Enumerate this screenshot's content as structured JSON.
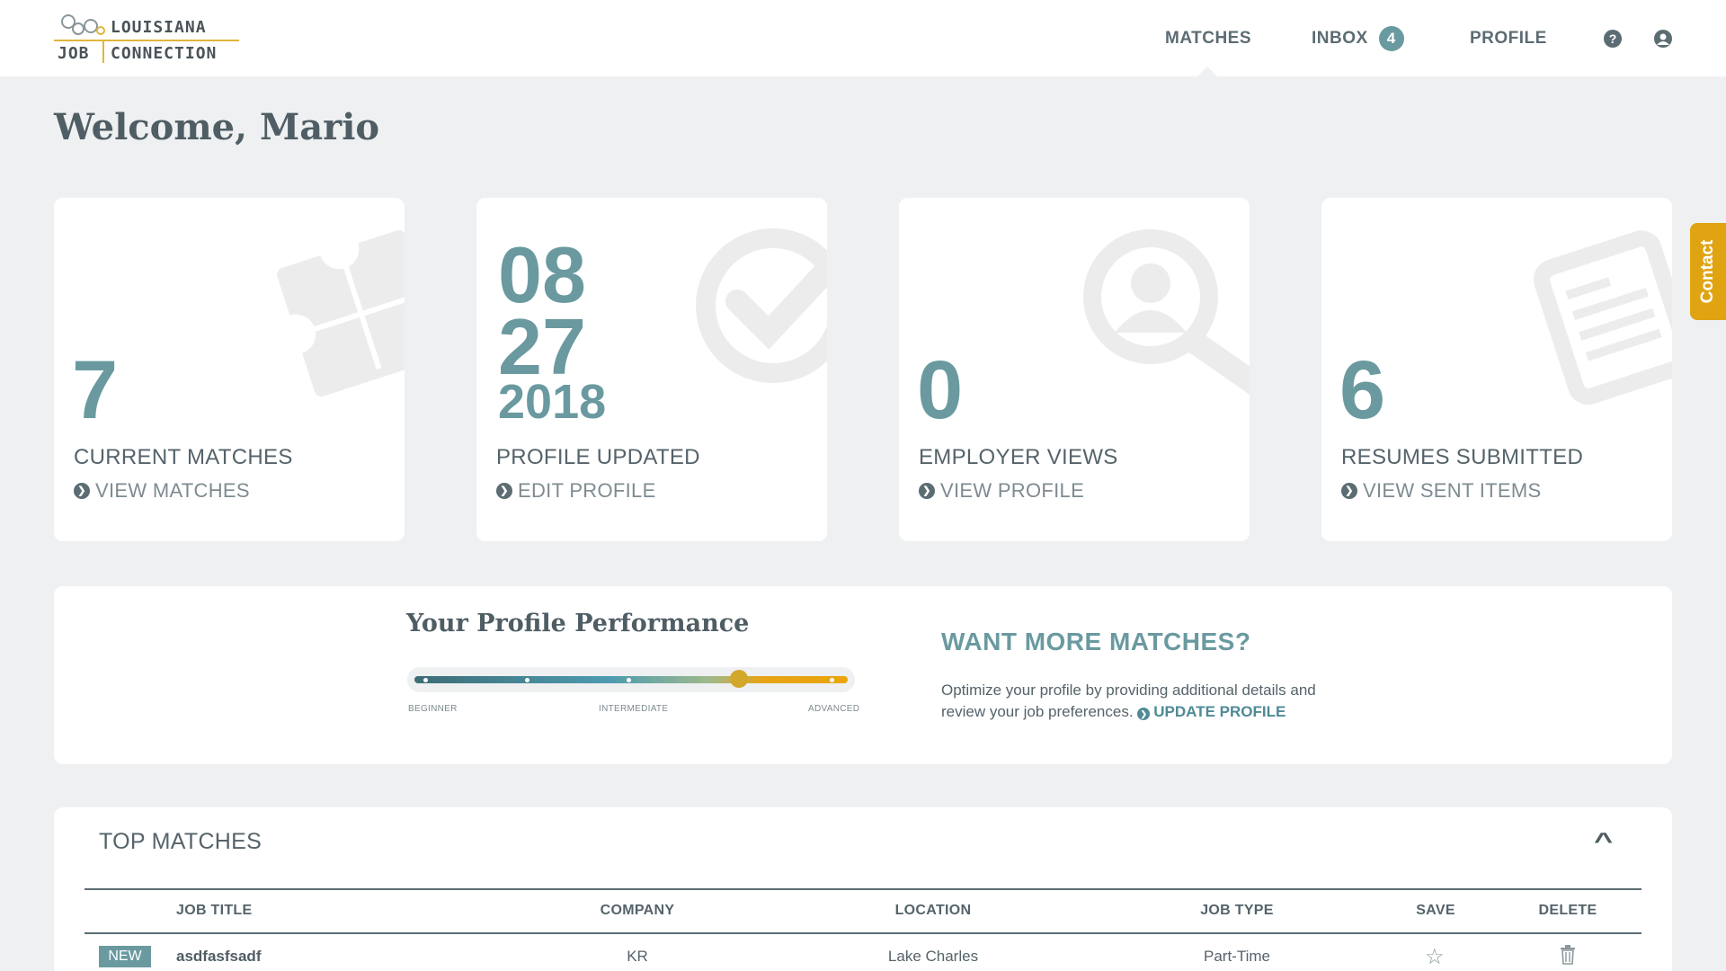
{
  "logo": {
    "line1": "LOUISIANA",
    "line2_left": "JOB",
    "line2_right": "CONNECTION"
  },
  "nav": {
    "matches": "MATCHES",
    "inbox": "INBOX",
    "inbox_count": "4",
    "profile": "PROFILE",
    "help_icon": "?",
    "user_icon": "user-circle-icon"
  },
  "welcome": "Welcome, Mario",
  "cards": [
    {
      "number": "7",
      "label": "CURRENT MATCHES",
      "link": "VIEW MATCHES",
      "icon": "puzzle-icon"
    },
    {
      "month": "08",
      "day": "27",
      "year": "2018",
      "label": "PROFILE UPDATED",
      "link": "EDIT PROFILE",
      "icon": "check-circle-icon"
    },
    {
      "number": "0",
      "label": "EMPLOYER VIEWS",
      "link": "VIEW PROFILE",
      "icon": "user-search-icon"
    },
    {
      "number": "6",
      "label": "RESUMES SUBMITTED",
      "link": "VIEW SENT ITEMS",
      "icon": "document-icon"
    }
  ],
  "contact_tab": "Contact",
  "performance": {
    "title": "Your Profile Performance",
    "level_fraction": 0.75,
    "labels": {
      "beginner": "BEGINNER",
      "intermediate": "INTERMEDIATE",
      "advanced": "ADVANCED"
    },
    "want_title": "WANT MORE MATCHES?",
    "want_text": "Optimize your profile by providing additional details and review your job preferences.",
    "want_link": "UPDATE PROFILE"
  },
  "top_matches": {
    "title": "TOP MATCHES",
    "headers": {
      "job_title": "JOB TITLE",
      "company": "COMPANY",
      "location": "LOCATION",
      "job_type": "JOB TYPE",
      "save": "SAVE",
      "delete": "DELETE"
    },
    "rows": [
      {
        "badge": "NEW",
        "job_title": "asdfasfsadf",
        "company": "KR",
        "location": "Lake Charles",
        "job_type": "Part-Time"
      }
    ]
  },
  "colors": {
    "accent": "#6a9aa0",
    "contact": "#e0a412",
    "background": "#eff0f1",
    "text": "#55636a"
  }
}
